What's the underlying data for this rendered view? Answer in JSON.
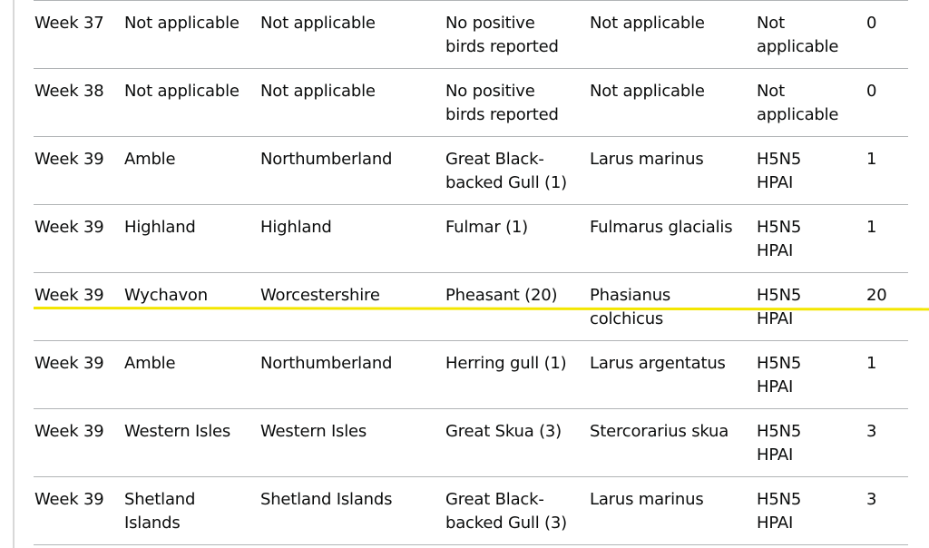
{
  "colors": {
    "highlight": "#f3e600",
    "border": "#b1b4b6"
  },
  "rows": [
    [
      "Week 37",
      "Not applicable",
      "Not applicable",
      "No positive\nbirds reported",
      "Not applicable",
      "Not\napplicable",
      "0"
    ],
    [
      "Week 38",
      "Not applicable",
      "Not applicable",
      "No positive\nbirds reported",
      "Not applicable",
      "Not\napplicable",
      "0"
    ],
    [
      "Week 39",
      "Amble",
      "Northumberland",
      "Great Black-\nbacked Gull (1)",
      "Larus marinus",
      "H5N5\nHPAI",
      "1"
    ],
    [
      "Week 39",
      "Highland",
      "Highland",
      "Fulmar (1)",
      "Fulmarus glacialis",
      "H5N5\nHPAI",
      "1"
    ],
    [
      "Week 39",
      "Wychavon",
      "Worcestershire",
      "Pheasant (20)",
      "Phasianus\ncolchicus",
      "H5N5\nHPAI",
      "20"
    ],
    [
      "Week 39",
      "Amble",
      "Northumberland",
      "Herring gull (1)",
      "Larus argentatus",
      "H5N5\nHPAI",
      "1"
    ],
    [
      "Week 39",
      "Western Isles",
      "Western Isles",
      "Great Skua (3)",
      "Stercorarius skua",
      "H5N5\nHPAI",
      "3"
    ],
    [
      "Week 39",
      "Shetland\nIslands",
      "Shetland Islands",
      "Great Black-\nbacked Gull (3)",
      "Larus marinus",
      "H5N5\nHPAI",
      "3"
    ]
  ]
}
